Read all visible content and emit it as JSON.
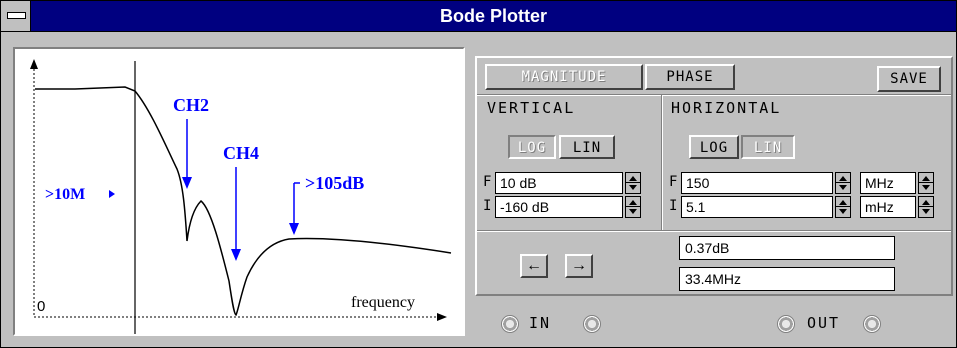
{
  "window": {
    "title": "Bode Plotter"
  },
  "graph": {
    "markers": {
      "ch2": "CH2",
      "ch4": "CH4",
      "left": ">10M",
      "right": ">105dB"
    },
    "origin_label": "0",
    "x_label": "frequency"
  },
  "mode": {
    "magnitude": "MAGNITUDE",
    "phase": "PHASE",
    "save": "SAVE",
    "selected": "PHASE"
  },
  "vertical": {
    "title": "VERTICAL",
    "log": "LOG",
    "lin": "LIN",
    "selected": "LIN",
    "final": {
      "label": "F",
      "value": "10 dB"
    },
    "initial": {
      "label": "I",
      "value": "-160 dB"
    }
  },
  "horizontal": {
    "title": "HORIZONTAL",
    "log": "LOG",
    "lin": "LIN",
    "selected": "LOG",
    "final": {
      "label": "F",
      "value": "150",
      "unit": "MHz"
    },
    "initial": {
      "label": "I",
      "value": "5.1",
      "unit": "mHz"
    }
  },
  "readout": {
    "magnitude": "0.37dB",
    "frequency": "33.4MHz",
    "left_arrow": "←",
    "right_arrow": "→"
  },
  "terminals": {
    "in": "IN",
    "out": "OUT"
  },
  "colors": {
    "title_bar": "#000080",
    "annotation": "#0000ff",
    "panel": "#c0c0c0"
  }
}
